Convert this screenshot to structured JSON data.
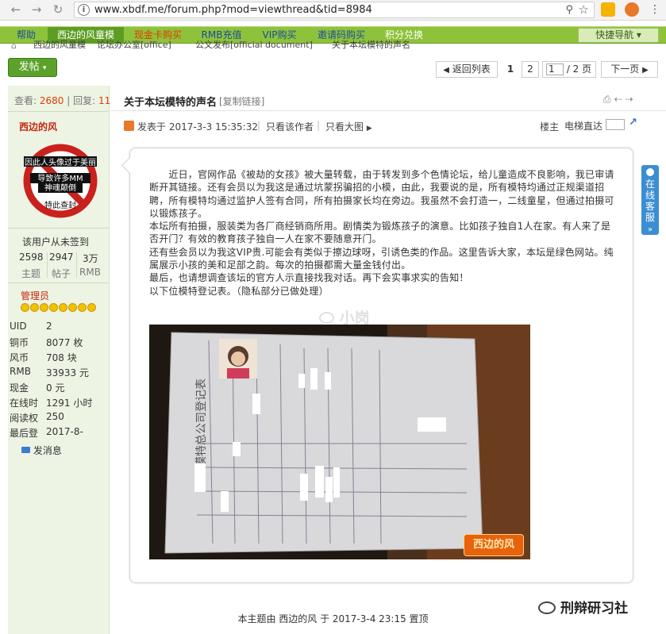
{
  "browser": {
    "url": "www.xbdf.me/forum.php?mod=viewthread&tid=8984"
  },
  "nav": {
    "items": [
      "帮助",
      "西边的风童模",
      "现金卡购买",
      "RMB充值",
      "VIP购买",
      "邀请码购买",
      "积分兑换"
    ],
    "quick": "快捷导航"
  },
  "breadcrumb": {
    "home": "西边的风童模",
    "office": "论坛办公室[office]",
    "doc": "公文发布[official document]",
    "thread": "关于本坛模特的声名"
  },
  "toolbar": {
    "post_button": "发帖",
    "back_list": "返回列表",
    "page1": "1",
    "page2": "2",
    "page_input": "1",
    "page_total": "/ 2 页",
    "next": "下一页"
  },
  "stats": {
    "views_label": "查看:",
    "views": "2680",
    "replies_label": "回复:",
    "replies": "11"
  },
  "thread": {
    "title": "关于本坛模特的声名",
    "copy_link": "[复制链接]",
    "posted": "发表于 2017-3-3 15:35:32",
    "only_author": "只看该作者",
    "big_image": "只看大图",
    "floor": "楼主",
    "jump": "电梯直达"
  },
  "author": {
    "name": "西边的风",
    "avatar_text": [
      "因此人头像过于美丽",
      "导致许多MM",
      "神魂颠倒",
      "特此查封"
    ],
    "checkin": "该用户从未签到",
    "stats": [
      {
        "value": "2598",
        "label": "主题"
      },
      {
        "value": "2947",
        "label": "帖子"
      },
      {
        "value": "3万",
        "label": "RMB"
      }
    ],
    "role": "管理员",
    "details": [
      {
        "label": "UID",
        "value": "2"
      },
      {
        "label": "铜币",
        "value": "8077 枚"
      },
      {
        "label": "风币",
        "value": "708 块"
      },
      {
        "label": "RMB",
        "value": "33933 元"
      },
      {
        "label": "现金",
        "value": "0 元"
      },
      {
        "label": "在线时",
        "value": "1291 小时"
      },
      {
        "label": "阅读权",
        "value": "250"
      },
      {
        "label": "最后登",
        "value": "2017-8-"
      }
    ],
    "message": "发消息"
  },
  "post": {
    "paragraphs": [
      "　　近日，官网作品《被劫的女孩》被大量转载，由于转发到多个色情论坛，给儿童造成不良影响，我已审请断开其链接。还有会员以为我这是通过坑蒙拐骗招的小模，由此，我要说的是，所有模特均通过正规渠道招聘，所有模特均通过监护人签有合同，所有拍摄家长均在旁边。我虽然不会打造一，二线童星，但通过拍摄可以锻炼孩子。",
      "本坛所有拍摄，服装类为各厂商经销商所用。剧情类为锻炼孩子的演意。比如孩子独自1人在家。有人来了是否开门？有效的教育孩子独自一人在家不要随意开门。",
      "还有些会员以为我这VIP贵.可能会有类似于擦边球呀，引诱色类的作品。这里告诉大家，本坛是绿色网站。纯属展示小孩的美和足部之韵。每次的拍摄都需大量金钱付出。",
      "最后，也请想调查该坛的官方人示直接找我对话。再下会实事求实的告知！",
      "以下位模特登记表。（隐私部分已做处理）"
    ],
    "watermark": "小岗",
    "photo_title": "模特总公司登记表",
    "photo_logo": "西边的风"
  },
  "footer": {
    "text": "本主题由 西边的风 于 2017-3-4 23:15 置顶"
  },
  "side_service": "在线客服",
  "wechat_account": "刑辩研习社",
  "colors": {
    "nav_green": "#8ec23b",
    "nav_active": "#5e9d23",
    "red": "#c2260e",
    "link_blue": "#1b4d9b"
  }
}
